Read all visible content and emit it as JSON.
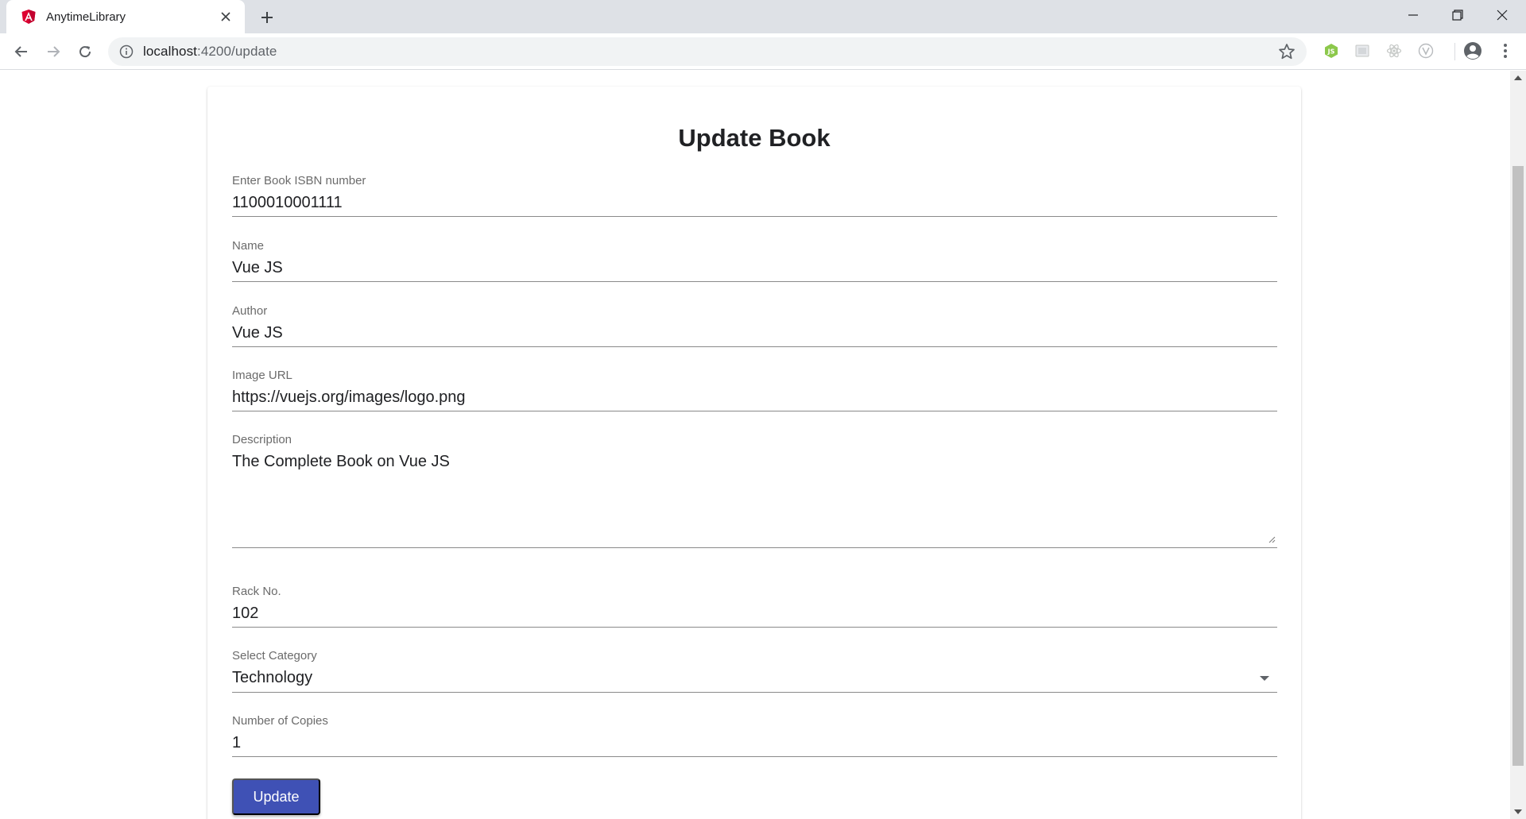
{
  "browser": {
    "tab_title": "AnytimeLibrary",
    "url_host": "localhost",
    "url_path": ":4200/update"
  },
  "form": {
    "title": "Update Book",
    "fields": [
      {
        "label": "Enter Book ISBN number",
        "value": "1100010001111"
      },
      {
        "label": "Name",
        "value": "Vue JS"
      },
      {
        "label": "Author",
        "value": "Vue JS"
      },
      {
        "label": "Image URL",
        "value": "https://vuejs.org/images/logo.png"
      },
      {
        "label": "Description",
        "value": "The Complete Book on Vue JS"
      },
      {
        "label": "Rack No.",
        "value": "102"
      },
      {
        "label": "Select Category",
        "value": "Technology"
      },
      {
        "label": "Number of Copies",
        "value": "1"
      }
    ],
    "submit_label": "Update"
  },
  "colors": {
    "primary": "#3f51b5",
    "angular_red": "#dd0031",
    "node_green": "#8cc84b"
  },
  "icons": [
    "angular-favicon-icon",
    "close-icon",
    "plus-icon",
    "minimize-icon",
    "restore-icon",
    "back-arrow-icon",
    "forward-arrow-icon",
    "reload-icon",
    "info-icon",
    "star-icon",
    "nodejs-extension-icon",
    "extension-icon",
    "react-extension-icon",
    "vue-extension-icon",
    "profile-icon",
    "kebab-menu-icon",
    "dropdown-arrow-icon"
  ]
}
